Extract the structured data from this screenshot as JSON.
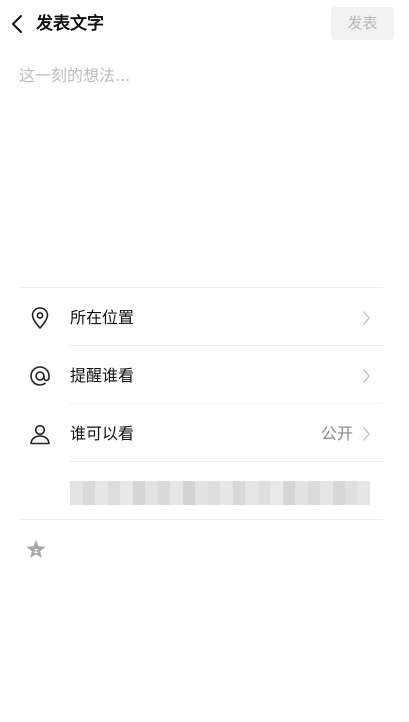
{
  "header": {
    "title": "发表文字",
    "publish_label": "发表"
  },
  "compose": {
    "placeholder": "这一刻的想法...",
    "value": ""
  },
  "options": [
    {
      "label": "所在位置",
      "icon": "location-pin-icon",
      "value": ""
    },
    {
      "label": "提醒谁看",
      "icon": "at-sign-icon",
      "value": ""
    },
    {
      "label": "谁可以看",
      "icon": "person-icon",
      "value": "公开"
    }
  ],
  "colors": {
    "publish_disabled_bg": "#f2f2f2",
    "publish_disabled_text": "#b7b7b7",
    "placeholder": "#bdbdbd",
    "divider": "#ececec"
  },
  "bottom_toolbar": {
    "icon": "sticker-icon"
  }
}
